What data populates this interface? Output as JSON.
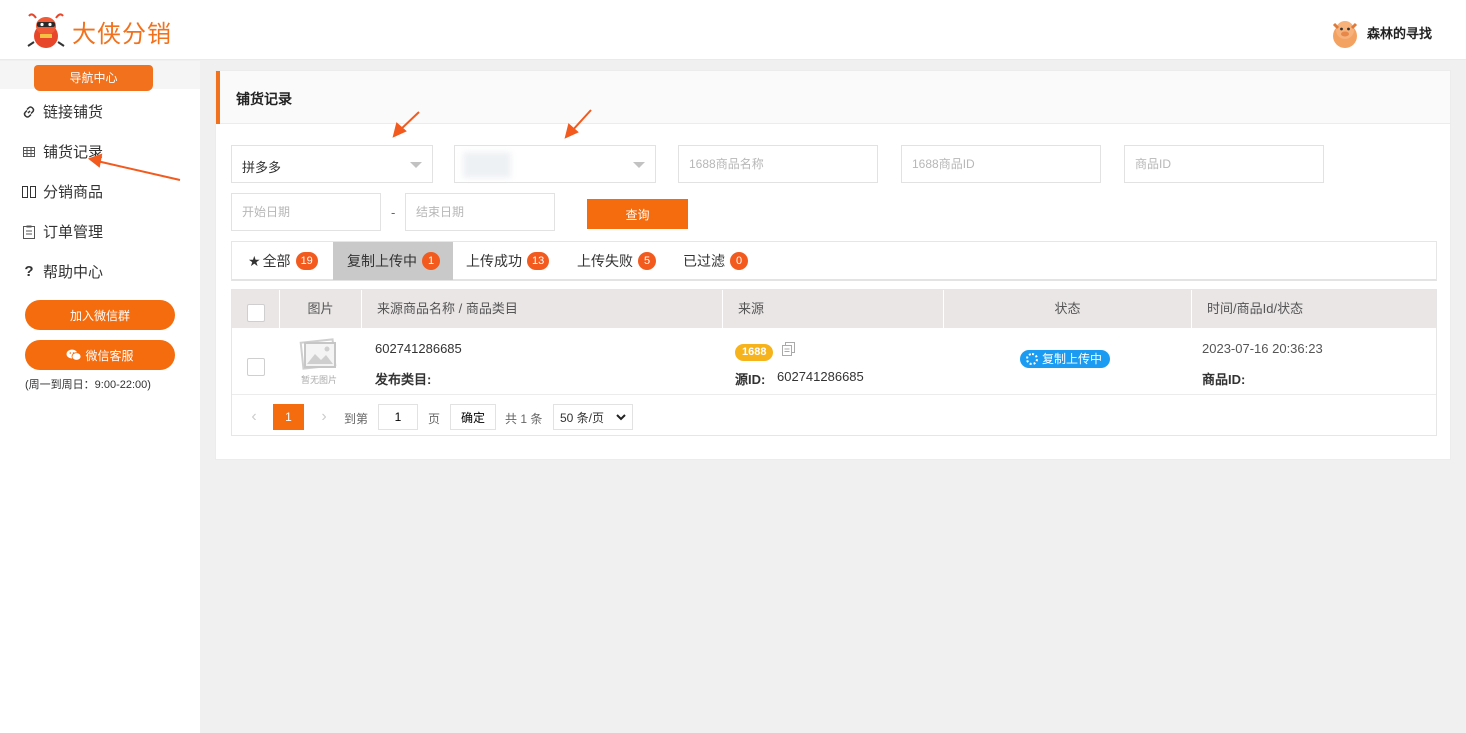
{
  "header": {
    "logo_text": "大侠分销",
    "user_name": "森林的寻找"
  },
  "sidebar": {
    "nav_tab_label": "导航中心",
    "items": [
      {
        "label": "链接铺货",
        "icon": "link-icon"
      },
      {
        "label": "铺货记录",
        "icon": "table-icon"
      },
      {
        "label": "分销商品",
        "icon": "columns-icon"
      },
      {
        "label": "订单管理",
        "icon": "clipboard-icon"
      },
      {
        "label": "帮助中心",
        "icon": "question-icon"
      }
    ],
    "join_wechat_group": "加入微信群",
    "wechat_service": "微信客服",
    "service_hours": "(周一到周日：9:00-22:00)"
  },
  "panel": {
    "title": "铺货记录",
    "platform_select": "拼多多",
    "store_select": "",
    "product_name_placeholder": "1688商品名称",
    "product_id_1688_placeholder": "1688商品ID",
    "product_id_placeholder": "商品ID",
    "start_date_placeholder": "开始日期",
    "date_separator": "-",
    "end_date_placeholder": "结束日期",
    "query_button": "查询"
  },
  "tabs": [
    {
      "label": "全部",
      "count": "19",
      "icon": "star-icon"
    },
    {
      "label": "复制上传中",
      "count": "1",
      "active": true
    },
    {
      "label": "上传成功",
      "count": "13"
    },
    {
      "label": "上传失败",
      "count": "5"
    },
    {
      "label": "已过滤",
      "count": "0"
    }
  ],
  "table": {
    "columns": [
      "图片",
      "来源商品名称 / 商品类目",
      "来源",
      "状态",
      "时间/商品Id/状态"
    ],
    "rows": [
      {
        "image_placeholder": "暂无图片",
        "source_product_name": "602741286685",
        "category_label": "发布类目:",
        "source_badge": "1688",
        "source_id_label": "源ID:",
        "source_id": "602741286685",
        "status": "复制上传中",
        "time": "2023-07-16 20:36:23",
        "product_id_label": "商品ID:"
      }
    ]
  },
  "pagination": {
    "current_page": "1",
    "goto_label": "到第",
    "page_input": "1",
    "page_unit": "页",
    "confirm": "确定",
    "total": "共 1 条",
    "page_size": "50 条/页"
  },
  "colors": {
    "accent": "#f46c0e",
    "badge": "#f25a1e",
    "status_blue": "#1b9cf2",
    "source_yellow": "#f6b31b"
  }
}
